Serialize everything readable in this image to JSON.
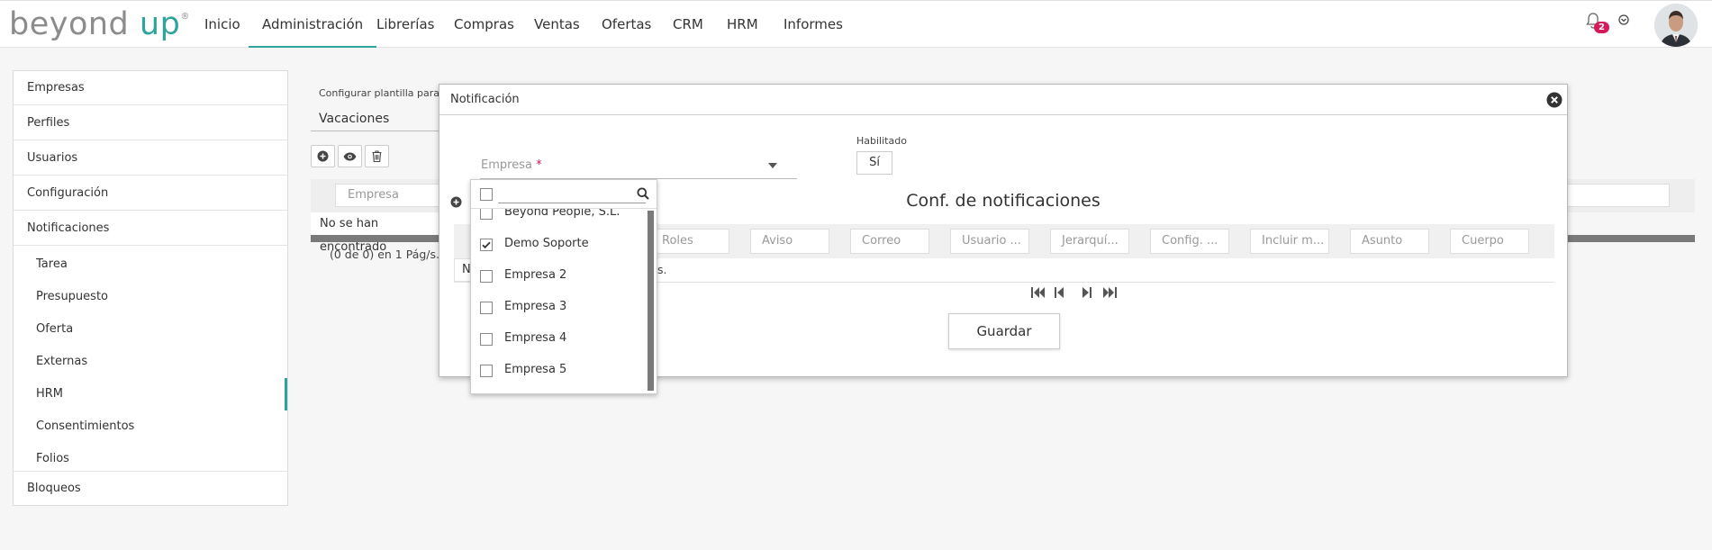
{
  "header": {
    "logo_main": "beyond ",
    "logo_up": "up",
    "logo_mark": "®",
    "nav": [
      "Inicio",
      "Administración",
      "Librerías",
      "Compras",
      "Ventas",
      "Ofertas",
      "CRM",
      "HRM",
      "Informes"
    ],
    "active_nav": "Administración",
    "notification_count": "2",
    "accent_color": "#2fa49a",
    "badge_color": "#d5195a"
  },
  "sidebar": {
    "top_items": [
      "Empresas",
      "Perfiles",
      "Usuarios",
      "Configuración",
      "Notificaciones"
    ],
    "sub_items": [
      "Tarea",
      "Presupuesto",
      "Oferta",
      "Externas",
      "HRM",
      "Consentimientos",
      "Folios"
    ],
    "selected_sub": "HRM",
    "bottom_item": "Bloqueos"
  },
  "background": {
    "config_label": "Configurar plantilla para",
    "required_mark": "*",
    "config_value": "Vacaciones",
    "filter_empresa": "Empresa",
    "no_results": "No se han encontrado",
    "pager_text": "(0 de 0) en 1 Pág/s."
  },
  "modal": {
    "title": "Notificación",
    "empresa_label": "Empresa",
    "required_mark": "*",
    "habilitado_label": "Habilitado",
    "habilitado_value": "Sí",
    "subtitle": "Conf. de notificaciones",
    "columns": [
      "Roles",
      "Aviso",
      "Correo",
      "Usuario ...",
      "Jerarquí...",
      "Config. ...",
      "Incluir m...",
      "Asunto",
      "Cuerpo"
    ],
    "row_start": "N",
    "row_tail": "s.",
    "save_label": "Guardar"
  },
  "dropdown": {
    "search_placeholder": "",
    "options": [
      {
        "label": "Beyond People, S.L.",
        "checked": false
      },
      {
        "label": "Demo Soporte",
        "checked": true
      },
      {
        "label": "Empresa 2",
        "checked": false
      },
      {
        "label": "Empresa 3",
        "checked": false
      },
      {
        "label": "Empresa 4",
        "checked": false
      },
      {
        "label": "Empresa 5",
        "checked": false
      }
    ]
  }
}
